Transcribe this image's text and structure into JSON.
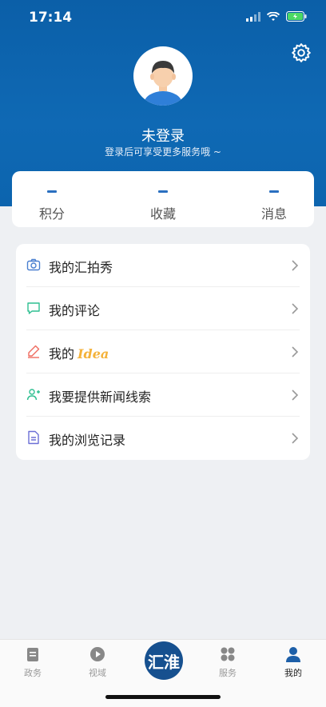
{
  "status": {
    "time": "17:14"
  },
  "profile": {
    "name": "未登录",
    "subtitle": "登录后可享受更多服务哦 ~"
  },
  "stats": [
    {
      "label": "积分"
    },
    {
      "label": "收藏"
    },
    {
      "label": "消息"
    }
  ],
  "menu": {
    "items": [
      {
        "label": "我的汇拍秀",
        "icon": "camera-icon",
        "color": "#4a7fd0"
      },
      {
        "label": "我的评论",
        "icon": "comment-icon",
        "color": "#2fbf91"
      },
      {
        "label": "我的",
        "label_suffix": "Idea",
        "icon": "pen-icon",
        "color": "#ef6b5f"
      },
      {
        "label": "我要提供新闻线索",
        "icon": "user-plus-icon",
        "color": "#2fbf91"
      },
      {
        "label": "我的浏览记录",
        "icon": "document-icon",
        "color": "#6b6fd6"
      }
    ]
  },
  "tabbar": {
    "tabs": [
      {
        "label": "政务",
        "icon": "clipboard-icon"
      },
      {
        "label": "视域",
        "icon": "play-icon"
      },
      {
        "label": "",
        "icon": "logo-icon"
      },
      {
        "label": "服务",
        "icon": "grid-icon"
      },
      {
        "label": "我的",
        "icon": "user-icon",
        "active": true
      }
    ],
    "logo_text": "汇淮"
  },
  "colors": {
    "header": "#0c64ae",
    "accent": "#2a6fc0"
  }
}
